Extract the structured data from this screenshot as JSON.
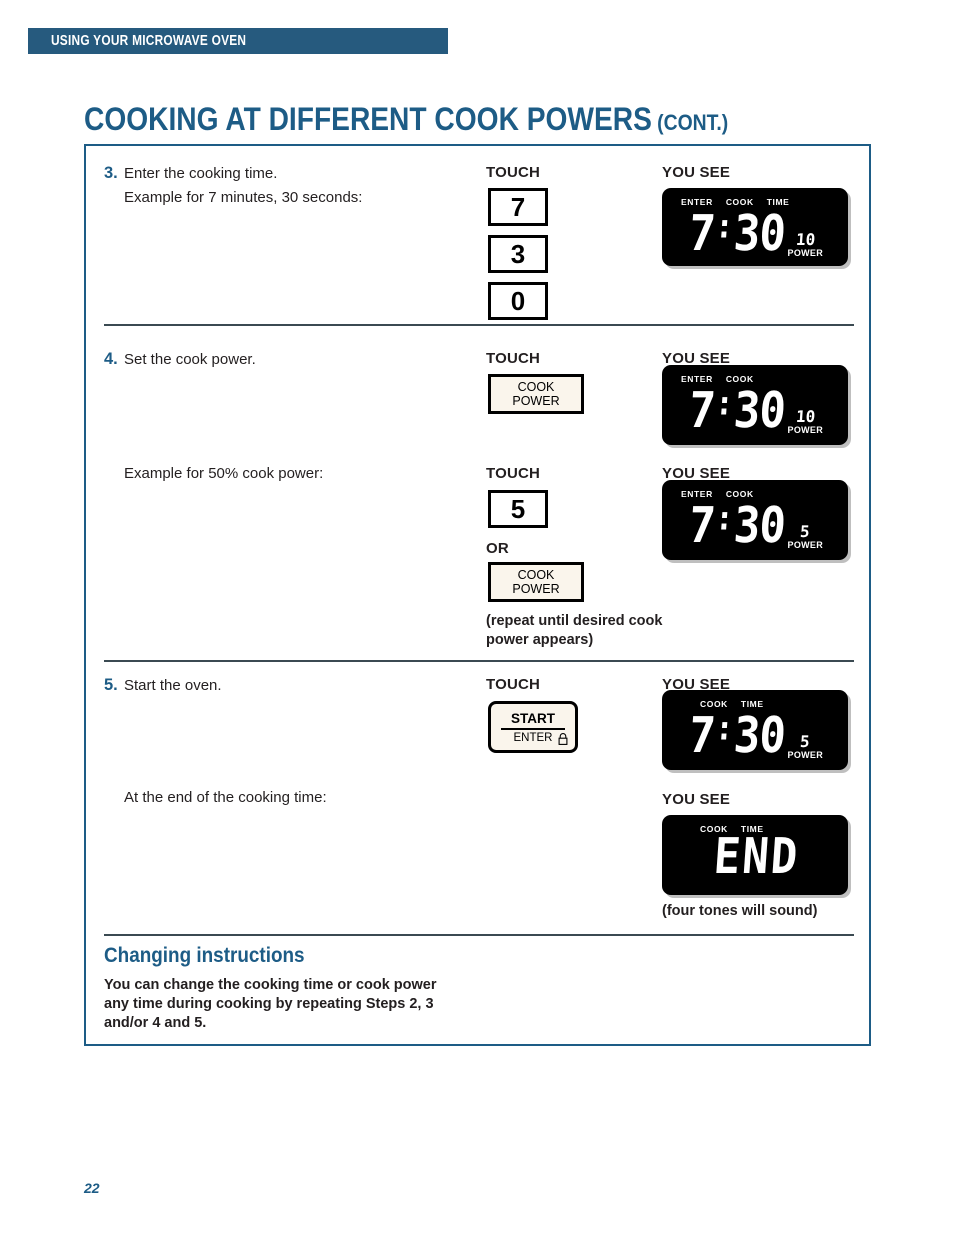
{
  "banner": {
    "text": "USING YOUR MICROWAVE OVEN"
  },
  "title": {
    "main": "COOKING AT DIFFERENT COOK POWERS",
    "cont": "(CONT.)"
  },
  "columns": {
    "touch": "TOUCH",
    "you_see": "YOU SEE"
  },
  "steps": [
    {
      "number": "3.",
      "text": "Enter the cooking time.",
      "subtext": "Example for 7 minutes, 30 seconds:",
      "keys": [
        "7",
        "3",
        "0"
      ],
      "display": {
        "labels": [
          "ENTER",
          "COOK",
          "TIME"
        ],
        "time": "7:30",
        "minutes": "7",
        "colon": ":",
        "seconds": "30",
        "power_value": "10",
        "power_label": "POWER"
      }
    },
    {
      "number": "4.",
      "text": "Set the cook power.",
      "key_label_line1": "COOK",
      "key_label_line2": "POWER",
      "display": {
        "labels": [
          "ENTER",
          "COOK"
        ],
        "minutes": "7",
        "colon": ":",
        "seconds": "30",
        "power_value": "10",
        "power_label": "POWER"
      },
      "subtext": "Example for 50% cook power:",
      "key_digit": "5",
      "or_label": "OR",
      "repeat_note": "(repeat until desired cook power appears)",
      "display2": {
        "labels": [
          "ENTER",
          "COOK"
        ],
        "minutes": "7",
        "colon": ":",
        "seconds": "30",
        "power_value": "5",
        "power_label": "POWER"
      }
    },
    {
      "number": "5.",
      "text": "Start the oven.",
      "start_top": "START",
      "start_bottom": "ENTER",
      "display": {
        "labels": [
          "COOK",
          "TIME"
        ],
        "minutes": "7",
        "colon": ":",
        "seconds": "30",
        "power_value": "5",
        "power_label": "POWER"
      },
      "subtext": "At the end of the cooking time:",
      "display2": {
        "labels": [
          "COOK",
          "TIME"
        ],
        "text": "END"
      },
      "tones_note": "(four tones will sound)"
    }
  ],
  "changing": {
    "heading": "Changing instructions",
    "body_line1": "You can change the cooking time or cook power",
    "body_line2": "any time during cooking by repeating Steps 2, 3",
    "body_line3": "and/or 4 and 5."
  },
  "page_number": "22",
  "colors": {
    "brand_blue": "#1d5c86",
    "banner_blue": "#265a7e",
    "key_cream": "#faf5ec",
    "display_black": "#000000"
  }
}
